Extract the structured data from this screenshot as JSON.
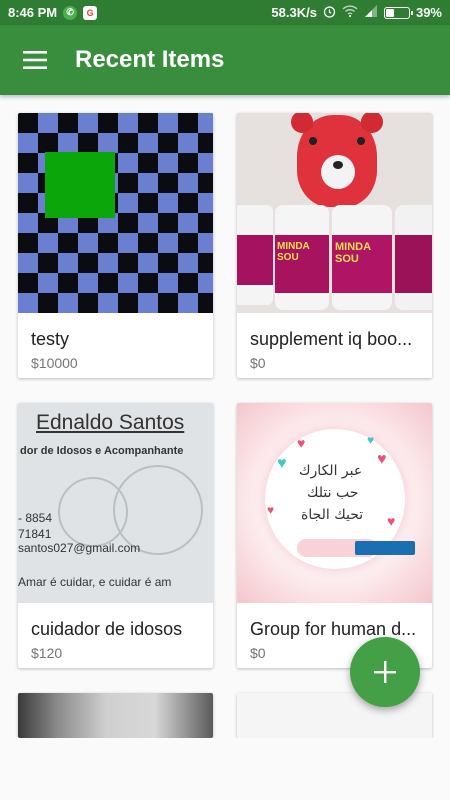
{
  "status_bar": {
    "time": "8:46 PM",
    "speed": "58.3K/s",
    "battery": "39%",
    "battery_level": 0.39,
    "icons": [
      "whatsapp-icon",
      "g-icon",
      "alarm-icon",
      "wifi-icon",
      "signal-icon",
      "battery-icon"
    ]
  },
  "app_bar": {
    "title": "Recent Items",
    "menu_icon": "hamburger-icon"
  },
  "items": [
    {
      "name": "testy",
      "price": "$10000",
      "image": "checkerboard-with-green-square"
    },
    {
      "name": "supplement iq boo...",
      "price": "$0",
      "image": "red-tiger-toy-and-supplement-bottles",
      "bottle_text": "MINDA SOU"
    },
    {
      "name": "cuidador de idosos",
      "price": "$120",
      "image": "business-card",
      "card_lines": [
        "Ednaldo Santos",
        "dor de Idosos e Acompanhante",
        "- 8854",
        "71841",
        "santos027@gmail.com",
        "Amar é cuidar, e cuidar é am"
      ]
    },
    {
      "name": "Group for human d...",
      "price": "$0",
      "image": "arabic-calligraphy-with-hearts",
      "calligraphy": [
        "عبر الكارك",
        "حب نتلك",
        "تحيك الجاة"
      ]
    },
    {
      "name": "",
      "price": "",
      "image": "partial-photo"
    },
    {
      "name": "",
      "price": "",
      "image": "partial-blank"
    }
  ],
  "fab": {
    "icon": "plus-icon"
  },
  "colors": {
    "primary": "#388e3c",
    "status_bar": "#2e7d32",
    "fab": "#43a047"
  }
}
